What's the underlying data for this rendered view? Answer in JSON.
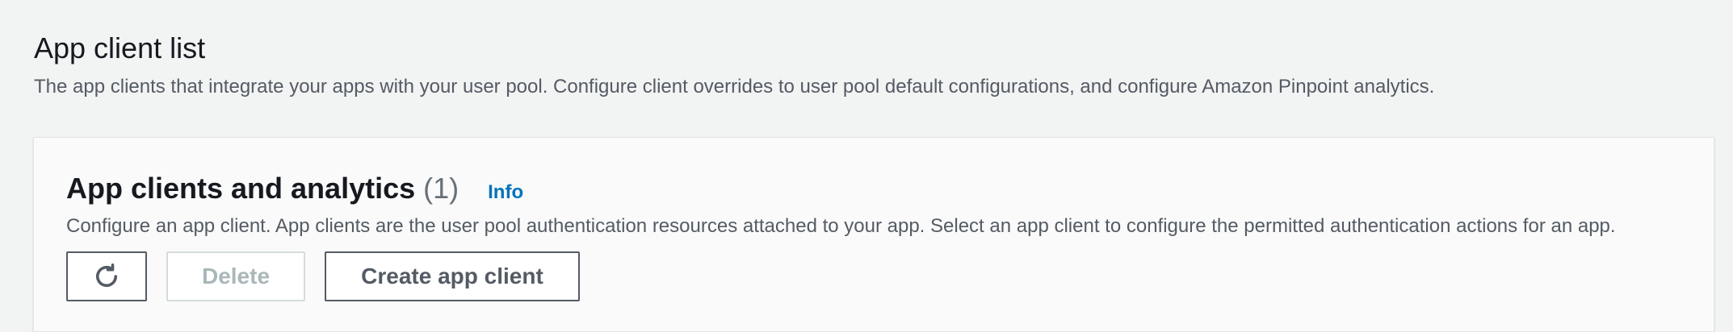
{
  "page": {
    "title": "App client list",
    "description": "The app clients that integrate your apps with your user pool. Configure client overrides to user pool default configurations, and configure Amazon Pinpoint analytics."
  },
  "panel": {
    "title": "App clients and analytics",
    "count": "(1)",
    "info_label": "Info",
    "description": "Configure an app client. App clients are the user pool authentication resources attached to your app. Select an app client to configure the permitted authentication actions for an app.",
    "actions": {
      "refresh_icon": "refresh-icon",
      "delete_label": "Delete",
      "delete_disabled": true,
      "create_label": "Create app client"
    }
  },
  "colors": {
    "page_bg": "#f2f3f3",
    "panel_bg": "#fafafa",
    "link": "#0073bb",
    "text_primary": "#16191f",
    "text_secondary": "#545b64",
    "disabled": "#aab7b8"
  }
}
